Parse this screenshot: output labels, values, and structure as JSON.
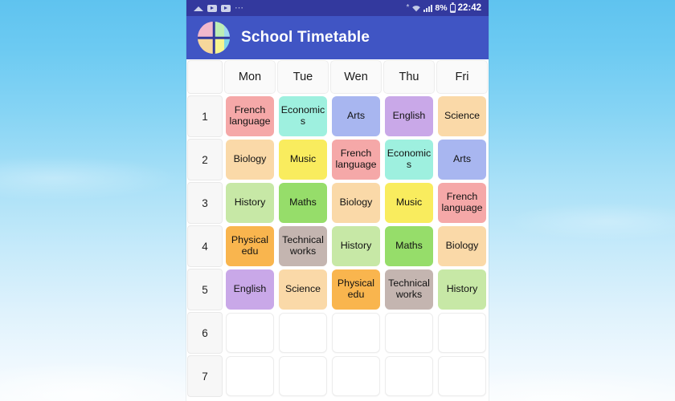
{
  "background": {
    "type": "sky-photo",
    "top_color": "#5fc3ef",
    "bottom_color": "#f7fbfe"
  },
  "status_bar": {
    "background": "#33399e",
    "left_icons": [
      "cloud-upload-icon",
      "video-icon",
      "video-icon",
      "more-dots-icon"
    ],
    "right_icons": [
      "bluetooth-icon",
      "wifi-icon",
      "signal-icon",
      "battery-icon"
    ],
    "battery_percent": "8%",
    "clock": "22:42"
  },
  "app_bar": {
    "background": "#4055c4",
    "icon_name": "school-timetable-app-icon",
    "icon_colors": [
      "#f2b8cd",
      "#bdeeb4",
      "#f6d79b",
      "#f7f58e",
      "#9fd9f0",
      "#7fd8e8"
    ],
    "title": "School Timetable"
  },
  "timetable": {
    "row_header_label": "",
    "days": [
      "Mon",
      "Tue",
      "Wen",
      "Thu",
      "Fri"
    ],
    "periods": [
      "1",
      "2",
      "3",
      "4",
      "5",
      "6",
      "7"
    ],
    "cells": [
      [
        {
          "label": "French language",
          "color": "#f5a8a8"
        },
        {
          "label": "Economics",
          "color": "#9ef0df"
        },
        {
          "label": "Arts",
          "color": "#a8b6f0"
        },
        {
          "label": "English",
          "color": "#c9a8e8"
        },
        {
          "label": "Science",
          "color": "#fad9a8"
        }
      ],
      [
        {
          "label": "Biology",
          "color": "#fad9a8"
        },
        {
          "label": "Music",
          "color": "#f9ec5e"
        },
        {
          "label": "French language",
          "color": "#f5a8a8"
        },
        {
          "label": "Economics",
          "color": "#9ef0df"
        },
        {
          "label": "Arts",
          "color": "#a8b6f0"
        }
      ],
      [
        {
          "label": "History",
          "color": "#c7e8a6"
        },
        {
          "label": "Maths",
          "color": "#96dd6a"
        },
        {
          "label": "Biology",
          "color": "#fad9a8"
        },
        {
          "label": "Music",
          "color": "#f9ec5e"
        },
        {
          "label": "French language",
          "color": "#f5a8a8"
        }
      ],
      [
        {
          "label": "Physical edu",
          "color": "#f9b54e"
        },
        {
          "label": "Technical works",
          "color": "#c4b5b0"
        },
        {
          "label": "History",
          "color": "#c7e8a6"
        },
        {
          "label": "Maths",
          "color": "#96dd6a"
        },
        {
          "label": "Biology",
          "color": "#fad9a8"
        }
      ],
      [
        {
          "label": "English",
          "color": "#c9a8e8"
        },
        {
          "label": "Science",
          "color": "#fad9a8"
        },
        {
          "label": "Physical edu",
          "color": "#f9b54e"
        },
        {
          "label": "Technical works",
          "color": "#c4b5b0"
        },
        {
          "label": "History",
          "color": "#c7e8a6"
        }
      ],
      [
        {
          "label": "",
          "color": ""
        },
        {
          "label": "",
          "color": ""
        },
        {
          "label": "",
          "color": ""
        },
        {
          "label": "",
          "color": ""
        },
        {
          "label": "",
          "color": ""
        }
      ],
      [
        {
          "label": "",
          "color": ""
        },
        {
          "label": "",
          "color": ""
        },
        {
          "label": "",
          "color": ""
        },
        {
          "label": "",
          "color": ""
        },
        {
          "label": "",
          "color": ""
        }
      ]
    ]
  }
}
